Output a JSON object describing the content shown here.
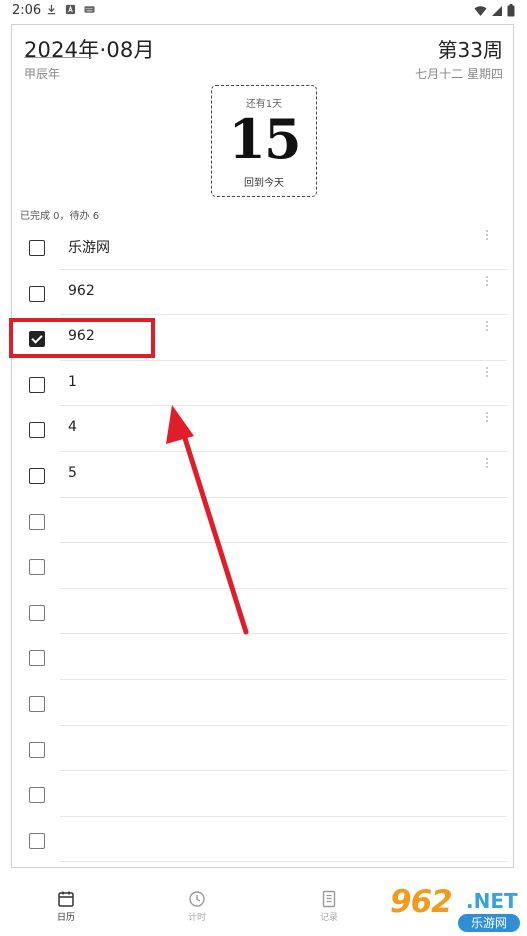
{
  "status_bar": {
    "time": "2:06"
  },
  "header": {
    "year_month": "2024年·08月",
    "ganzhi_year": "甲辰年",
    "week_number": "第33周",
    "lunar_and_weekday": "七月十二  星期四"
  },
  "day_card": {
    "remaining": "还有1天",
    "day": "15",
    "back_to_today": "回到今天"
  },
  "summary": "已完成 0，待办 6",
  "todos": [
    {
      "text": "乐游网",
      "checked": false
    },
    {
      "text": "962",
      "checked": false
    },
    {
      "text": "962",
      "checked": true
    },
    {
      "text": "1",
      "checked": false
    },
    {
      "text": "4",
      "checked": false
    },
    {
      "text": "5",
      "checked": false
    }
  ],
  "empty_rows": 8,
  "bottom_nav": [
    {
      "label": "日历",
      "icon": "calendar-icon",
      "active": true
    },
    {
      "label": "计时",
      "icon": "clock-icon",
      "active": false
    },
    {
      "label": "记录",
      "icon": "notes-icon",
      "active": false
    }
  ],
  "watermark": {
    "number": "962",
    "dot_net": ".NET",
    "cn": "乐游网"
  },
  "colors": {
    "annotation_red": "#e01e2a",
    "accent_text": "#222222"
  }
}
